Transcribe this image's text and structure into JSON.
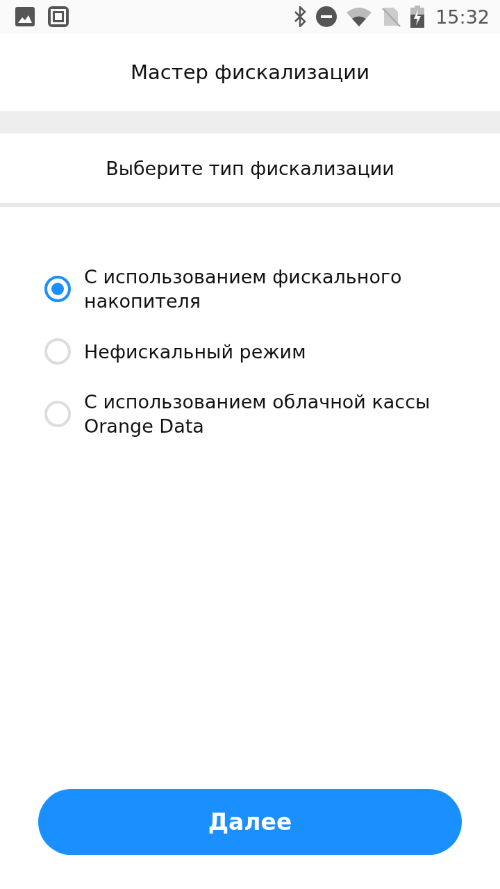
{
  "status_bar": {
    "time": "15:32"
  },
  "header": {
    "title": "Мастер фискализации"
  },
  "subheader": {
    "title": "Выберите тип фискализации"
  },
  "options": [
    {
      "label": "С использованием фискального накопителя",
      "selected": true
    },
    {
      "label": "Нефискальный режим",
      "selected": false
    },
    {
      "label": "С использованием облачной кассы Orange Data",
      "selected": false
    }
  ],
  "next_button": {
    "label": "Далее"
  }
}
